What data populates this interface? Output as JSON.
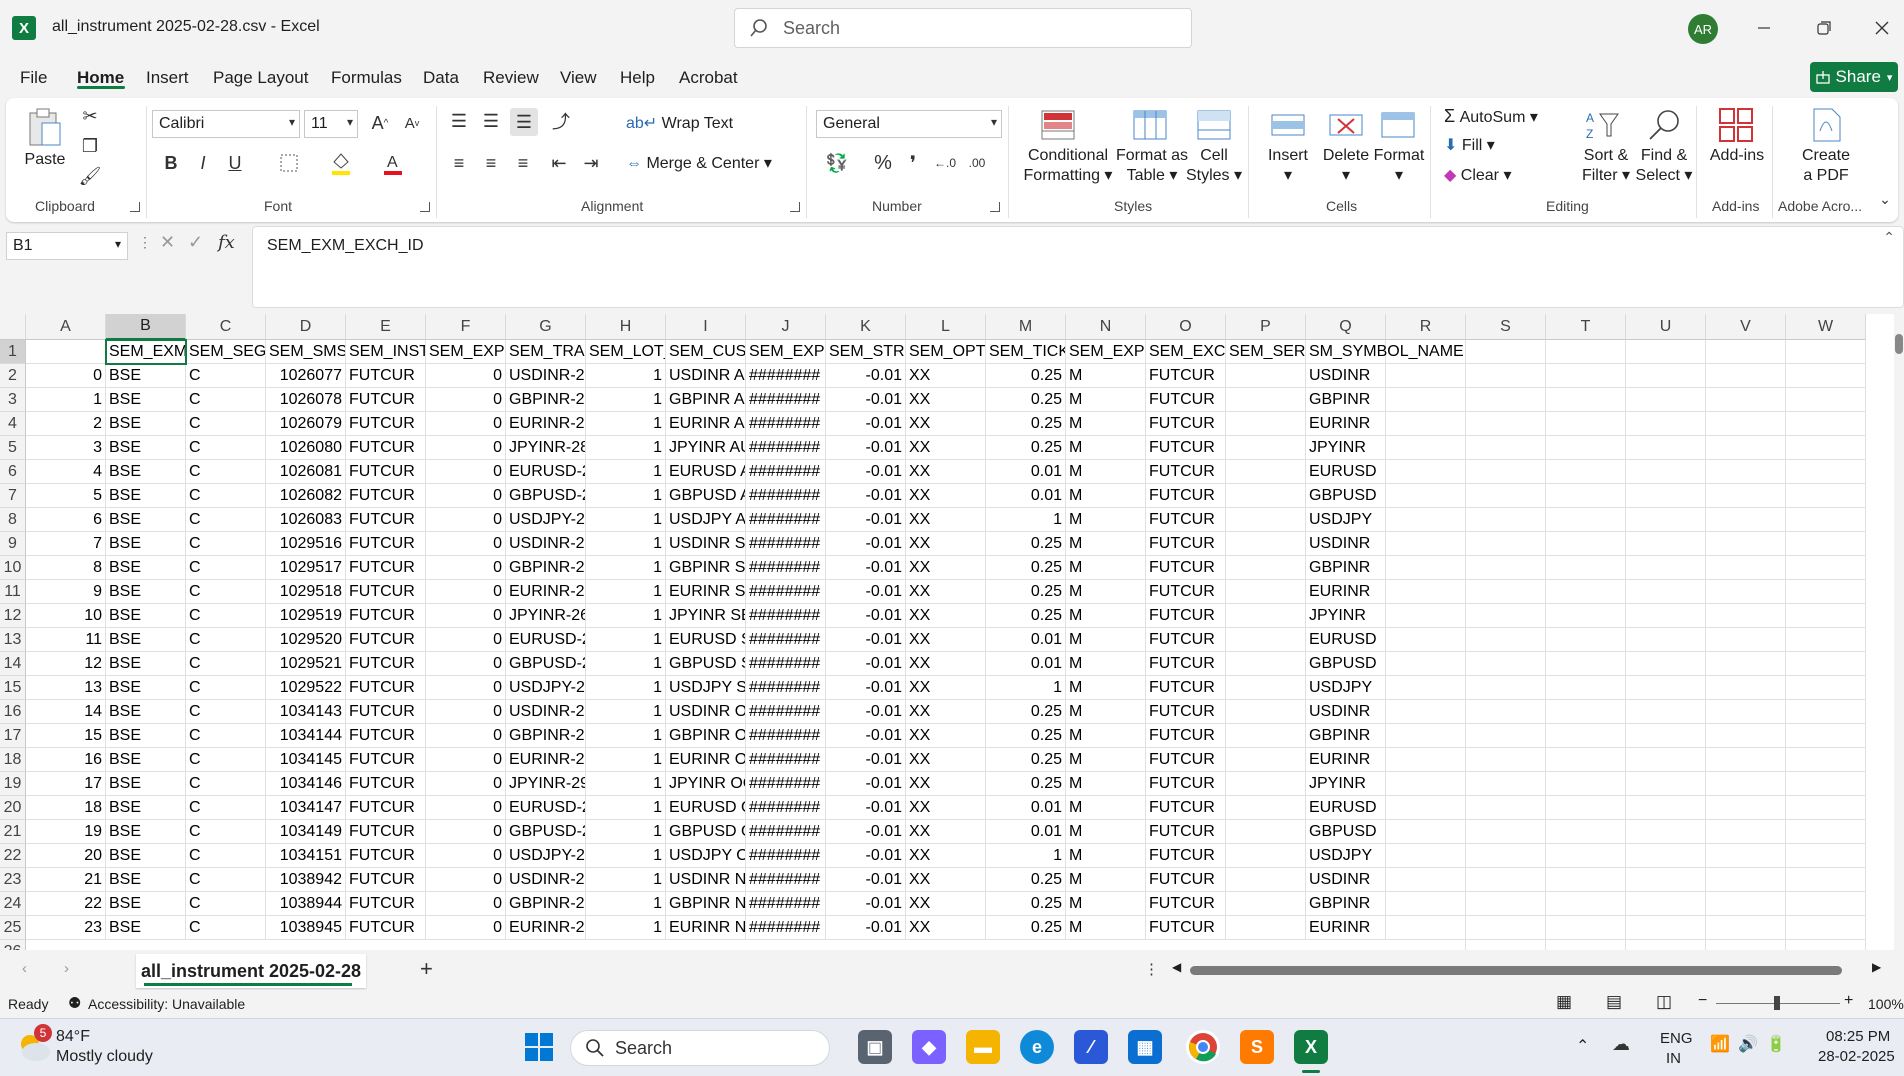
{
  "window": {
    "title": "all_instrument 2025-02-28.csv  -  Excel",
    "search_placeholder": "Search",
    "avatar": "AR",
    "logo": "X"
  },
  "menu": {
    "tabs": [
      "File",
      "Home",
      "Insert",
      "Page Layout",
      "Formulas",
      "Data",
      "Review",
      "View",
      "Help",
      "Acrobat"
    ],
    "share": "Share"
  },
  "ribbon": {
    "clipboard": {
      "paste": "Paste",
      "label": "Clipboard"
    },
    "font": {
      "name": "Calibri",
      "size": "11",
      "label": "Font",
      "bold": "B",
      "italic": "I",
      "underline": "U"
    },
    "alignment": {
      "wrap": "Wrap Text",
      "merge": "Merge & Center",
      "label": "Alignment"
    },
    "number": {
      "format": "General",
      "label": "Number"
    },
    "styles": {
      "cond1": "Conditional",
      "cond2": "Formatting",
      "fmt1": "Format as",
      "fmt2": "Table",
      "cell1": "Cell",
      "cell2": "Styles",
      "label": "Styles"
    },
    "cells": {
      "insert": "Insert",
      "delete": "Delete",
      "format": "Format",
      "label": "Cells"
    },
    "editing": {
      "autosum": "AutoSum",
      "fill": "Fill",
      "clear": "Clear",
      "sort1": "Sort &",
      "sort2": "Filter",
      "find1": "Find &",
      "find2": "Select",
      "label": "Editing"
    },
    "addins": {
      "btn": "Add-ins",
      "label": "Add-ins"
    },
    "adobe": {
      "btn1": "Create",
      "btn2": "a PDF",
      "label": "Adobe Acro..."
    }
  },
  "formula_bar": {
    "name_box": "B1",
    "content": "SEM_EXM_EXCH_ID",
    "fx": "fx"
  },
  "sheet": {
    "columns": [
      "A",
      "B",
      "C",
      "D",
      "E",
      "F",
      "G",
      "H",
      "I",
      "J",
      "K",
      "L",
      "M",
      "N",
      "O",
      "P",
      "Q",
      "R",
      "S",
      "T",
      "U",
      "V",
      "W"
    ],
    "row_numbers": [
      "1",
      "2",
      "3",
      "4",
      "5",
      "6",
      "7",
      "8",
      "9",
      "10",
      "11",
      "12",
      "13",
      "14",
      "15",
      "16",
      "17",
      "18",
      "19",
      "20",
      "21",
      "22",
      "23",
      "24",
      "25",
      "26"
    ],
    "header_row": [
      "",
      "SEM_EXM",
      "SEM_SEGM",
      "SEM_SMST",
      "SEM_INST",
      "SEM_EXPII",
      "SEM_TRAD",
      "SEM_LOT_",
      "SEM_CUST",
      "SEM_EXPII",
      "SEM_STRII",
      "SEM_OPTI",
      "SEM_TICK",
      "SEM_EXPII",
      "SEM_EXCH",
      "SEM_SERII",
      "SM_SYMBOL_NAME"
    ],
    "rows": [
      [
        "0",
        "BSE",
        "C",
        "1026077",
        "FUTCUR",
        "0",
        "USDINR-28",
        "1",
        "USDINR AU",
        "########",
        "-0.01",
        "XX",
        "0.25",
        "M",
        "FUTCUR",
        "",
        "USDINR"
      ],
      [
        "1",
        "BSE",
        "C",
        "1026078",
        "FUTCUR",
        "0",
        "GBPINR-28",
        "1",
        "GBPINR AU",
        "########",
        "-0.01",
        "XX",
        "0.25",
        "M",
        "FUTCUR",
        "",
        "GBPINR"
      ],
      [
        "2",
        "BSE",
        "C",
        "1026079",
        "FUTCUR",
        "0",
        "EURINR-28",
        "1",
        "EURINR AU",
        "########",
        "-0.01",
        "XX",
        "0.25",
        "M",
        "FUTCUR",
        "",
        "EURINR"
      ],
      [
        "3",
        "BSE",
        "C",
        "1026080",
        "FUTCUR",
        "0",
        "JPYINR-28",
        "1",
        "JPYINR AU",
        "########",
        "-0.01",
        "XX",
        "0.25",
        "M",
        "FUTCUR",
        "",
        "JPYINR"
      ],
      [
        "4",
        "BSE",
        "C",
        "1026081",
        "FUTCUR",
        "0",
        "EURUSD-2",
        "1",
        "EURUSD A",
        "########",
        "-0.01",
        "XX",
        "0.01",
        "M",
        "FUTCUR",
        "",
        "EURUSD"
      ],
      [
        "5",
        "BSE",
        "C",
        "1026082",
        "FUTCUR",
        "0",
        "GBPUSD-2",
        "1",
        "GBPUSD A",
        "########",
        "-0.01",
        "XX",
        "0.01",
        "M",
        "FUTCUR",
        "",
        "GBPUSD"
      ],
      [
        "6",
        "BSE",
        "C",
        "1026083",
        "FUTCUR",
        "0",
        "USDJPY-28",
        "1",
        "USDJPY AU",
        "########",
        "-0.01",
        "XX",
        "1",
        "M",
        "FUTCUR",
        "",
        "USDJPY"
      ],
      [
        "7",
        "BSE",
        "C",
        "1029516",
        "FUTCUR",
        "0",
        "USDINR-26",
        "1",
        "USDINR SE",
        "########",
        "-0.01",
        "XX",
        "0.25",
        "M",
        "FUTCUR",
        "",
        "USDINR"
      ],
      [
        "8",
        "BSE",
        "C",
        "1029517",
        "FUTCUR",
        "0",
        "GBPINR-26",
        "1",
        "GBPINR SE",
        "########",
        "-0.01",
        "XX",
        "0.25",
        "M",
        "FUTCUR",
        "",
        "GBPINR"
      ],
      [
        "9",
        "BSE",
        "C",
        "1029518",
        "FUTCUR",
        "0",
        "EURINR-26",
        "1",
        "EURINR SE",
        "########",
        "-0.01",
        "XX",
        "0.25",
        "M",
        "FUTCUR",
        "",
        "EURINR"
      ],
      [
        "10",
        "BSE",
        "C",
        "1029519",
        "FUTCUR",
        "0",
        "JPYINR-26",
        "1",
        "JPYINR SEI",
        "########",
        "-0.01",
        "XX",
        "0.25",
        "M",
        "FUTCUR",
        "",
        "JPYINR"
      ],
      [
        "11",
        "BSE",
        "C",
        "1029520",
        "FUTCUR",
        "0",
        "EURUSD-2",
        "1",
        "EURUSD SI",
        "########",
        "-0.01",
        "XX",
        "0.01",
        "M",
        "FUTCUR",
        "",
        "EURUSD"
      ],
      [
        "12",
        "BSE",
        "C",
        "1029521",
        "FUTCUR",
        "0",
        "GBPUSD-2",
        "1",
        "GBPUSD SI",
        "########",
        "-0.01",
        "XX",
        "0.01",
        "M",
        "FUTCUR",
        "",
        "GBPUSD"
      ],
      [
        "13",
        "BSE",
        "C",
        "1029522",
        "FUTCUR",
        "0",
        "USDJPY-26",
        "1",
        "USDJPY SE",
        "########",
        "-0.01",
        "XX",
        "1",
        "M",
        "FUTCUR",
        "",
        "USDJPY"
      ],
      [
        "14",
        "BSE",
        "C",
        "1034143",
        "FUTCUR",
        "0",
        "USDINR-29",
        "1",
        "USDINR OC",
        "########",
        "-0.01",
        "XX",
        "0.25",
        "M",
        "FUTCUR",
        "",
        "USDINR"
      ],
      [
        "15",
        "BSE",
        "C",
        "1034144",
        "FUTCUR",
        "0",
        "GBPINR-29",
        "1",
        "GBPINR OC",
        "########",
        "-0.01",
        "XX",
        "0.25",
        "M",
        "FUTCUR",
        "",
        "GBPINR"
      ],
      [
        "16",
        "BSE",
        "C",
        "1034145",
        "FUTCUR",
        "0",
        "EURINR-29",
        "1",
        "EURINR OC",
        "########",
        "-0.01",
        "XX",
        "0.25",
        "M",
        "FUTCUR",
        "",
        "EURINR"
      ],
      [
        "17",
        "BSE",
        "C",
        "1034146",
        "FUTCUR",
        "0",
        "JPYINR-29",
        "1",
        "JPYINR OC",
        "########",
        "-0.01",
        "XX",
        "0.25",
        "M",
        "FUTCUR",
        "",
        "JPYINR"
      ],
      [
        "18",
        "BSE",
        "C",
        "1034147",
        "FUTCUR",
        "0",
        "EURUSD-2",
        "1",
        "EURUSD O",
        "########",
        "-0.01",
        "XX",
        "0.01",
        "M",
        "FUTCUR",
        "",
        "EURUSD"
      ],
      [
        "19",
        "BSE",
        "C",
        "1034149",
        "FUTCUR",
        "0",
        "GBPUSD-2",
        "1",
        "GBPUSD O",
        "########",
        "-0.01",
        "XX",
        "0.01",
        "M",
        "FUTCUR",
        "",
        "GBPUSD"
      ],
      [
        "20",
        "BSE",
        "C",
        "1034151",
        "FUTCUR",
        "0",
        "USDJPY-29",
        "1",
        "USDJPY OC",
        "########",
        "-0.01",
        "XX",
        "1",
        "M",
        "FUTCUR",
        "",
        "USDJPY"
      ],
      [
        "21",
        "BSE",
        "C",
        "1038942",
        "FUTCUR",
        "0",
        "USDINR-27",
        "1",
        "USDINR NO",
        "########",
        "-0.01",
        "XX",
        "0.25",
        "M",
        "FUTCUR",
        "",
        "USDINR"
      ],
      [
        "22",
        "BSE",
        "C",
        "1038944",
        "FUTCUR",
        "0",
        "GBPINR-27",
        "1",
        "GBPINR NO",
        "########",
        "-0.01",
        "XX",
        "0.25",
        "M",
        "FUTCUR",
        "",
        "GBPINR"
      ],
      [
        "23",
        "BSE",
        "C",
        "1038945",
        "FUTCUR",
        "0",
        "EURINR-27",
        "1",
        "EURINR NO",
        "########",
        "-0.01",
        "XX",
        "0.25",
        "M",
        "FUTCUR",
        "",
        "EURINR"
      ]
    ],
    "tab_name": "all_instrument 2025-02-28"
  },
  "status": {
    "ready": "Ready",
    "accessibility": "Accessibility: Unavailable",
    "zoom": "100%"
  },
  "taskbar": {
    "weather_temp": "84°F",
    "weather_desc": "Mostly cloudy",
    "weather_badge": "5",
    "search": "Search",
    "lang1": "ENG",
    "lang2": "IN",
    "time": "08:25 PM",
    "date": "28-02-2025"
  },
  "colors": {
    "accent": "#107c41",
    "ribbon_bg": "#ffffff",
    "chrome_bg": "#f3f3f3"
  }
}
